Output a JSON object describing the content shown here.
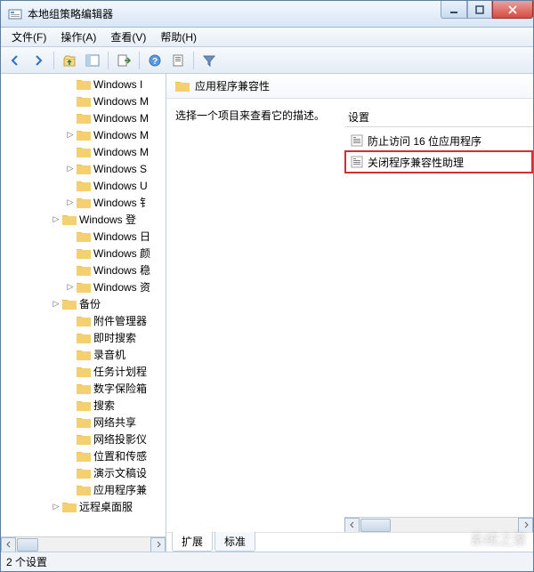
{
  "window": {
    "title": "本地组策略编辑器"
  },
  "menu": {
    "file": "文件(F)",
    "action": "操作(A)",
    "view": "查看(V)",
    "help": "帮助(H)"
  },
  "tree": {
    "items": [
      {
        "label": "Windows I",
        "expander": "",
        "indent": 72
      },
      {
        "label": "Windows M",
        "expander": "",
        "indent": 72
      },
      {
        "label": "Windows M",
        "expander": "",
        "indent": 72
      },
      {
        "label": "Windows M",
        "expander": "▷",
        "indent": 72
      },
      {
        "label": "Windows M",
        "expander": "",
        "indent": 72
      },
      {
        "label": "Windows S",
        "expander": "▷",
        "indent": 72
      },
      {
        "label": "Windows U",
        "expander": "",
        "indent": 72
      },
      {
        "label": "Windows 钅",
        "expander": "▷",
        "indent": 72
      },
      {
        "label": "Windows 登",
        "expander": "▷",
        "indent": 56
      },
      {
        "label": "Windows 日",
        "expander": "",
        "indent": 72
      },
      {
        "label": "Windows 颜",
        "expander": "",
        "indent": 72
      },
      {
        "label": "Windows 稳",
        "expander": "",
        "indent": 72
      },
      {
        "label": "Windows 资",
        "expander": "▷",
        "indent": 72
      },
      {
        "label": "备份",
        "expander": "▷",
        "indent": 56
      },
      {
        "label": "附件管理器",
        "expander": "",
        "indent": 72
      },
      {
        "label": "即时搜索",
        "expander": "",
        "indent": 72
      },
      {
        "label": "录音机",
        "expander": "",
        "indent": 72
      },
      {
        "label": "任务计划程",
        "expander": "",
        "indent": 72
      },
      {
        "label": "数字保险箱",
        "expander": "",
        "indent": 72
      },
      {
        "label": "搜索",
        "expander": "",
        "indent": 72
      },
      {
        "label": "网络共享",
        "expander": "",
        "indent": 72
      },
      {
        "label": "网络投影仪",
        "expander": "",
        "indent": 72
      },
      {
        "label": "位置和传感",
        "expander": "",
        "indent": 72
      },
      {
        "label": "演示文稿设",
        "expander": "",
        "indent": 72
      },
      {
        "label": "应用程序兼",
        "expander": "",
        "indent": 72
      },
      {
        "label": "远程桌面服",
        "expander": "▷",
        "indent": 56
      }
    ]
  },
  "detail": {
    "title": "应用程序兼容性",
    "description": "选择一个项目来查看它的描述。",
    "column_header": "设置",
    "settings": [
      {
        "label": "防止访问 16 位应用程序",
        "highlighted": false
      },
      {
        "label": "关闭程序兼容性助理",
        "highlighted": true
      }
    ],
    "tabs": {
      "extended": "扩展",
      "standard": "标准"
    }
  },
  "status": {
    "text": "2 个设置"
  },
  "watermark": "系统之家"
}
